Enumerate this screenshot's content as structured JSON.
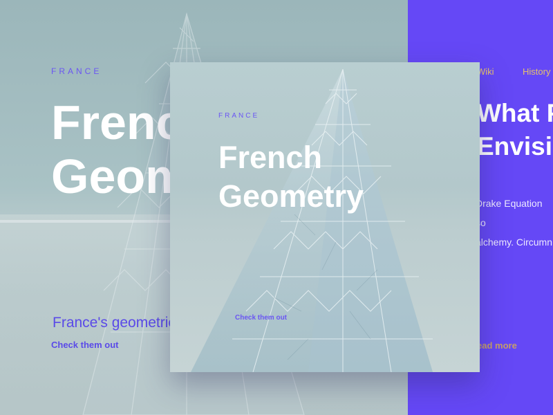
{
  "background_section": {
    "eyebrow": "FRANCE",
    "title": "French\nGeometry",
    "description": "France's geometric",
    "cta": "Check them out"
  },
  "card": {
    "eyebrow": "FRANCE",
    "title": "French\nGeometry",
    "cta": "Check them out"
  },
  "purple_panel": {
    "nav": {
      "wiki": "Wiki",
      "history": "History"
    },
    "heading": "What P\nEnvision",
    "body": "Drake Equation so\nalchemy. Circumn",
    "cta": "ead more"
  },
  "colors": {
    "accent_purple": "#6548f6",
    "eyebrow_purple": "#6a55f3",
    "nav_gold": "#e6c26c",
    "teal_bg": "#9fb9bd"
  }
}
